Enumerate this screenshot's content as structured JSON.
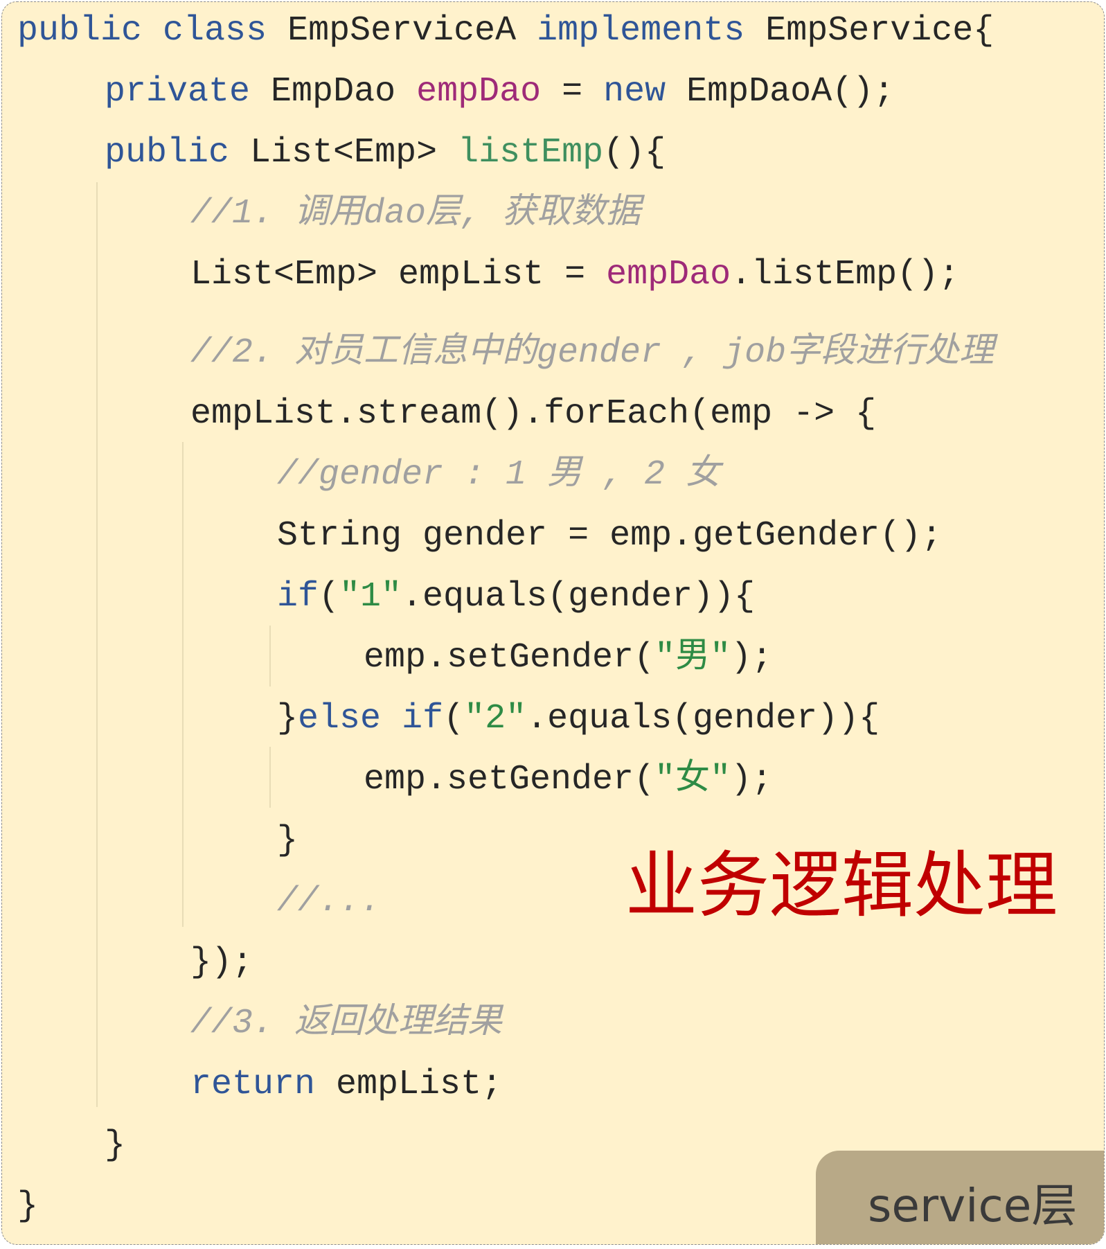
{
  "code": {
    "lines": [
      [
        {
          "t": "public",
          "c": "kw"
        },
        {
          "t": " "
        },
        {
          "t": "class",
          "c": "kw"
        },
        {
          "t": " EmpServiceA "
        },
        {
          "t": "implements",
          "c": "kw"
        },
        {
          "t": " EmpService{"
        }
      ],
      [
        {
          "t": "private",
          "c": "kw"
        },
        {
          "t": " EmpDao "
        },
        {
          "t": "empDao",
          "c": "fld"
        },
        {
          "t": " = "
        },
        {
          "t": "new",
          "c": "kw"
        },
        {
          "t": " EmpDaoA();"
        }
      ],
      [
        {
          "t": "public",
          "c": "kw"
        },
        {
          "t": " List<Emp> "
        },
        {
          "t": "listEmp",
          "c": "fn"
        },
        {
          "t": "(){"
        }
      ],
      [
        {
          "t": "//1. 调用dao层, 获取数据",
          "c": "cmt"
        }
      ],
      [
        {
          "t": "List<Emp> empList = "
        },
        {
          "t": "empDao",
          "c": "fld"
        },
        {
          "t": ".listEmp();"
        }
      ],
      [
        {
          "t": "//2. 对员工信息中的gender , job字段进行处理",
          "c": "cmt"
        }
      ],
      [
        {
          "t": "empList.stream().forEach(emp -> {"
        }
      ],
      [
        {
          "t": "//gender : 1 男 , 2 女",
          "c": "cmt"
        }
      ],
      [
        {
          "t": "String gender = emp.getGender();"
        }
      ],
      [
        {
          "t": "if",
          "c": "kw"
        },
        {
          "t": "("
        },
        {
          "t": "\"1\"",
          "c": "str"
        },
        {
          "t": ".equals(gender)){"
        }
      ],
      [
        {
          "t": "emp.setGender("
        },
        {
          "t": "\"男\"",
          "c": "str"
        },
        {
          "t": ");"
        }
      ],
      [
        {
          "t": "}"
        },
        {
          "t": "else",
          "c": "kw"
        },
        {
          "t": " "
        },
        {
          "t": "if",
          "c": "kw"
        },
        {
          "t": "("
        },
        {
          "t": "\"2\"",
          "c": "str"
        },
        {
          "t": ".equals(gender)){"
        }
      ],
      [
        {
          "t": "emp.setGender("
        },
        {
          "t": "\"女\"",
          "c": "str"
        },
        {
          "t": ");"
        }
      ],
      [
        {
          "t": "}"
        }
      ],
      [
        {
          "t": "//...",
          "c": "cmt"
        }
      ],
      [
        {
          "t": "});"
        }
      ],
      [
        {
          "t": "//3. 返回处理结果",
          "c": "cmt"
        }
      ],
      [
        {
          "t": "return",
          "c": "kw"
        },
        {
          "t": " empList;"
        }
      ],
      [
        {
          "t": "}"
        }
      ],
      [
        {
          "t": "}"
        }
      ]
    ]
  },
  "annotation": "业务逻辑处理",
  "layer_label": "service层",
  "colors": {
    "background": "#fff2cc",
    "keyword": "#2f5597",
    "method": "#3f8f5f",
    "field": "#9e2a78",
    "string": "#2e8b45",
    "comment": "#a0a0a0",
    "annotation": "#c00000",
    "layer_tag": "#b8a987"
  }
}
